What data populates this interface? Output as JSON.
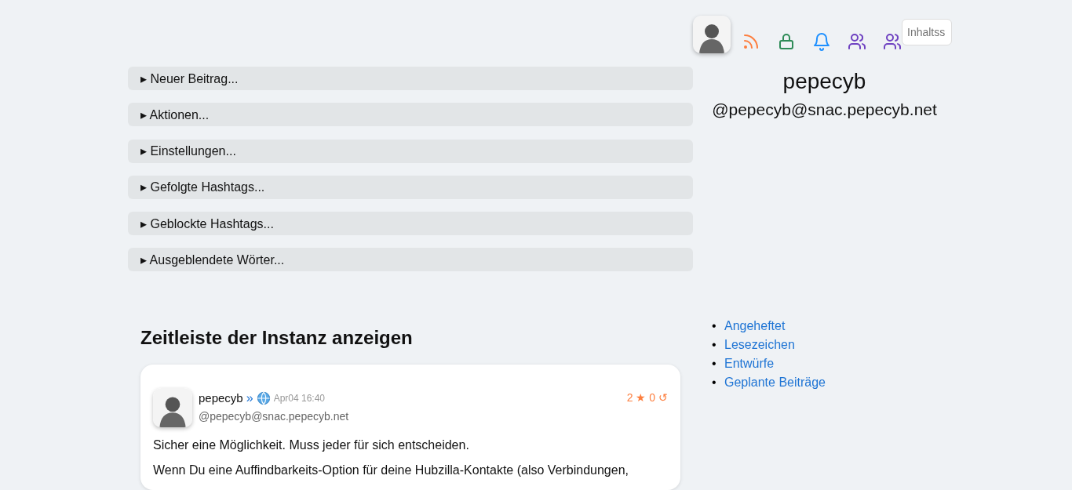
{
  "sections": [
    {
      "label": "▸ Neuer Beitrag...",
      "expanded": false
    },
    {
      "label": "▸ Aktionen...",
      "expanded": false
    },
    {
      "label": "▸ Einstellungen...",
      "expanded": false
    },
    {
      "label": "▸ Gefolgte Hashtags...",
      "expanded": false
    },
    {
      "label": "▸ Geblockte Hashtags...",
      "expanded": false
    },
    {
      "label": "▸ Ausgeblendete Wörter...",
      "expanded": false
    }
  ],
  "timeline": {
    "heading": "Zeitleiste der Instanz anzeigen",
    "posts": [
      {
        "author": "pepecyb",
        "separator": "»",
        "time": "Apr04 16:40",
        "handle": "@pepecyb@snac.pepecyb.net",
        "stats": "2 ★ 0 ↺",
        "paragraphs": [
          "Sicher eine Möglichkeit. Muss jeder für sich entscheiden.",
          "Wenn Du eine Auffindbarkeits-Option für deine Hubzilla-Kontakte (also Verbindungen,"
        ]
      }
    ]
  },
  "profile": {
    "name": "pepecyb",
    "handle": "@pepecyb@snac.pepecyb.net"
  },
  "toolbar": {
    "icons": [
      {
        "kind": "rss",
        "color": "#fd7e3e"
      },
      {
        "kind": "lock",
        "color": "#2e8b57"
      },
      {
        "kind": "bell",
        "color": "#1e90ff"
      },
      {
        "kind": "people",
        "color": "#6f42c1"
      },
      {
        "kind": "people",
        "color": "#6f42c1"
      }
    ],
    "search": {
      "placeholder": "Inhaltss"
    }
  },
  "links": [
    {
      "bullet": "•",
      "label": "Angeheftet"
    },
    {
      "bullet": "•",
      "label": "Lesezeichen"
    },
    {
      "bullet": "•",
      "label": "Entwürfe"
    },
    {
      "bullet": "•",
      "label": "Geplante Beiträge"
    }
  ]
}
